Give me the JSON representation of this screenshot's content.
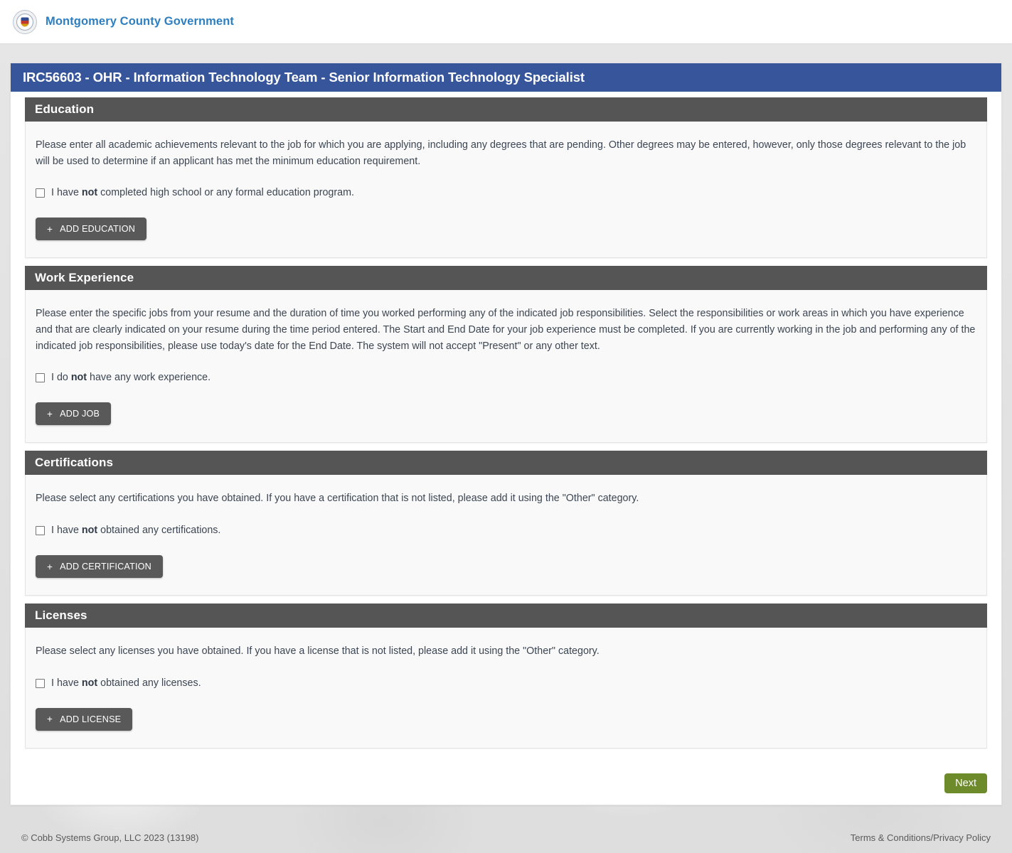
{
  "brand": {
    "logo_icon": "county-seal-icon",
    "name": "Montgomery County Government"
  },
  "job": {
    "title": "IRC56603 - OHR - Information Technology Team - Senior Information Technology Specialist"
  },
  "sections": [
    {
      "key": "education",
      "heading": "Education",
      "description": "Please enter all academic achievements relevant to the job for which you are applying, including any degrees that are pending. Other degrees may be entered, however, only those degrees relevant to the job will be used to determine if an applicant has met the minimum education requirement.",
      "checkbox": {
        "prefix": "I have ",
        "emphasis": "not",
        "suffix": " completed high school or any formal education program.",
        "checked": false
      },
      "button": {
        "icon": "plus-icon",
        "label": "ADD EDUCATION"
      }
    },
    {
      "key": "work_experience",
      "heading": "Work Experience",
      "description": "Please enter the specific jobs from your resume and the duration of time you worked performing any of the indicated job responsibilities. Select the responsibilities or work areas in which you have experience and that are clearly indicated on your resume during the time period entered. The Start and End Date for your job experience must be completed. If you are currently working in the job and performing any of the indicated job responsibilities, please use today's date for the End Date. The system will not accept \"Present\" or any other text.",
      "checkbox": {
        "prefix": "I do ",
        "emphasis": "not",
        "suffix": " have any work experience.",
        "checked": false
      },
      "button": {
        "icon": "plus-icon",
        "label": "ADD JOB"
      }
    },
    {
      "key": "certifications",
      "heading": "Certifications",
      "description": "Please select any certifications you have obtained. If you have a certification that is not listed, please add it using the \"Other\" category.",
      "checkbox": {
        "prefix": "I have ",
        "emphasis": "not",
        "suffix": " obtained any certifications.",
        "checked": false
      },
      "button": {
        "icon": "plus-icon",
        "label": "ADD CERTIFICATION"
      }
    },
    {
      "key": "licenses",
      "heading": "Licenses",
      "description": "Please select any licenses you have obtained. If you have a license that is not listed, please add it using the \"Other\" category.",
      "checkbox": {
        "prefix": "I have ",
        "emphasis": "not",
        "suffix": " obtained any licenses.",
        "checked": false
      },
      "button": {
        "icon": "plus-icon",
        "label": "ADD LICENSE"
      }
    }
  ],
  "navigation": {
    "next_label": "Next"
  },
  "footer": {
    "copyright": "© Cobb Systems Group, LLC 2023 (13198)",
    "legal_link": "Terms & Conditions/Privacy Policy"
  },
  "colors": {
    "title_bar": "#36559a",
    "panel_header": "#555555",
    "add_button": "#595959",
    "next_button": "#6e8b2b",
    "brand_text": "#2d7fc1"
  }
}
